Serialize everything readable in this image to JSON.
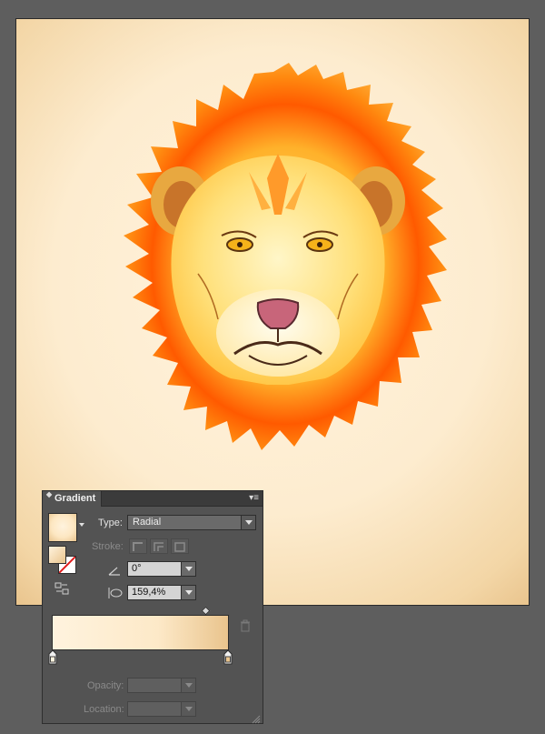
{
  "gradient_panel": {
    "title": "Gradient",
    "type_label": "Type:",
    "type_value": "Radial",
    "stroke_label": "Stroke:",
    "angle_value": "0°",
    "aspect_ratio_value": "159,4%",
    "opacity_label": "Opacity:",
    "opacity_value": "",
    "location_label": "Location:",
    "location_value": "",
    "gradient_colors": [
      "#fff3de",
      "#e9c48d"
    ]
  },
  "colors": {
    "app_background": "#5e5e5e",
    "panel_background": "#535353",
    "mane_outer": "#ff8c00",
    "mane_inner": "#ff4e00",
    "face": "#ffd66a"
  },
  "icons": [
    "panel-collapse-arrows-icon",
    "panel-menu-icon",
    "angle-icon",
    "aspect-ratio-icon",
    "reverse-gradient-icon",
    "delete-stop-icon"
  ]
}
